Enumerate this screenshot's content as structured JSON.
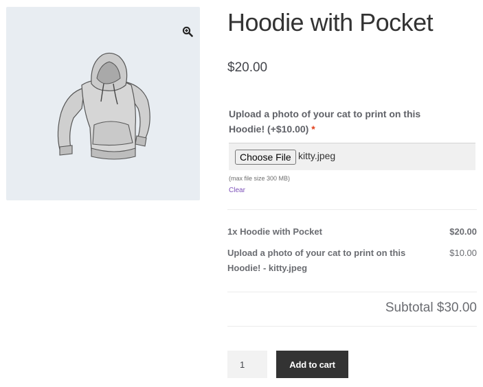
{
  "product": {
    "title": "Hoodie with Pocket",
    "price": "$20.00",
    "image_icon": "hoodie-image",
    "zoom_icon": "magnifier-plus-icon"
  },
  "addon": {
    "label": "Upload a photo of your cat to print on this Hoodie! (+$10.00)",
    "required_mark": "*",
    "choose_file_label": "Choose File",
    "file_name": "kitty.jpeg",
    "max_size_hint": "(max file size 300 MB)",
    "clear_label": "Clear"
  },
  "totals": {
    "lines": [
      {
        "label": "1x Hoodie with Pocket",
        "amount": "$20.00"
      },
      {
        "label": "Upload a photo of your cat to print on this Hoodie! - kitty.jpeg",
        "amount": "$10.00"
      }
    ],
    "subtotal": "Subtotal $30.00"
  },
  "cart": {
    "quantity": "1",
    "add_to_cart_label": "Add to cart"
  },
  "colors": {
    "gallery_bg": "#e8edf2",
    "button_bg": "#333333",
    "required": "#e2401c",
    "link": "#7b4fb8"
  }
}
